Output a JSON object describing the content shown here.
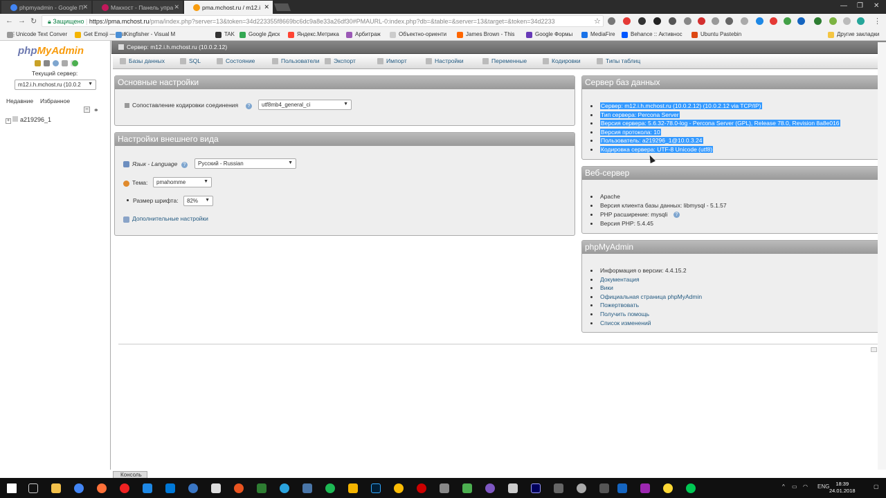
{
  "browser": {
    "tabs": [
      {
        "title": "phpmyadmin - Google П",
        "color": "#4285f4"
      },
      {
        "title": "Макхост - Панель упра",
        "color": "#c2185b"
      },
      {
        "title": "pma.mchost.ru / m12.i",
        "color": "#f89c0e"
      }
    ],
    "url": {
      "secure_label": "Защищено",
      "host": "https://pma.mchost.ru",
      "rest": "/pma/index.php?server=13&token=34d223355f8669bc6dc9a8e33a26df30#PMAURL-0:index.php?db=&table=&server=13&target=&token=34d2233"
    },
    "bookmarks": [
      {
        "label": "Unicode Text Conver",
        "color": "#999999"
      },
      {
        "label": "Get Emoji — List",
        "color": "#f4b400"
      },
      {
        "label": "Kingfisher - Visual M",
        "color": "#4a8fd6"
      },
      {
        "label": "TAK",
        "color": "#333333"
      },
      {
        "label": "Google Диск",
        "color": "#34a853"
      },
      {
        "label": "Яндекс.Метрика",
        "color": "#ff4433"
      },
      {
        "label": "Арбитраж",
        "color": "#9b59b6"
      },
      {
        "label": "Объектно-ориенти",
        "color": "#cccccc"
      },
      {
        "label": "James Brown - This",
        "color": "#ff6600"
      },
      {
        "label": "Google Формы",
        "color": "#673ab7"
      },
      {
        "label": "MediaFire",
        "color": "#1a73e8"
      },
      {
        "label": "Behance :: Активнос",
        "color": "#0057ff"
      },
      {
        "label": "Ubuntu Pastebin",
        "color": "#dd4814"
      }
    ],
    "other_bookmarks": "Другие закладки"
  },
  "sidebar": {
    "logo_php": "php",
    "logo_myadmin": "MyAdmin",
    "current_server_label": "Текущий сервер:",
    "server_value": "m12.i.h.mchost.ru (10.0.2",
    "recent_label": "Недавние",
    "favorites_label": "Избранное",
    "databases": [
      {
        "name": "a219296_1"
      }
    ]
  },
  "breadcrumb": "Сервер: m12.i.h.mchost.ru (10.0.2.12)",
  "menu": [
    "Базы данных",
    "SQL",
    "Состояние",
    "Пользователи",
    "Экспорт",
    "Импорт",
    "Настройки",
    "Переменные",
    "Кодировки",
    "Типы таблиц"
  ],
  "general_settings": {
    "title": "Основные настройки",
    "collation_label": "Сопоставление кодировки соединения",
    "collation_value": "utf8mb4_general_ci"
  },
  "appearance": {
    "title": "Настройки внешнего вида",
    "language_label": "Язык - Language",
    "language_value": "Русский - Russian",
    "theme_label": "Тема:",
    "theme_value": "pmahomme",
    "font_label": "Размер шрифта:",
    "font_value": "82%",
    "more_settings": "Дополнительные настройки"
  },
  "db_server": {
    "title": "Сервер баз данных",
    "items": [
      "Сервер: m12.i.h.mchost.ru (10.0.2.12) (10.0.2.12 via TCP/IP)",
      "Тип сервера: Percona Server",
      "Версия сервера: 5.6.32-78.0-log - Percona Server (GPL), Release 78.0, Revision 8a8e016",
      "Версия протокола: 10",
      "Пользователь: a219296_1@10.0.3.24",
      "Кодировка сервера: UTF-8 Unicode (utf8)"
    ]
  },
  "web_server": {
    "title": "Веб-сервер",
    "items": [
      "Apache",
      "Версия клиента базы данных: libmysql - 5.1.57",
      "PHP расширение: mysqli",
      "Версия PHP: 5.4.45"
    ]
  },
  "pma": {
    "title": "phpMyAdmin",
    "items": [
      "Информация о версии: 4.4.15.2",
      "Документация",
      "Вики",
      "Официальная страница phpMyAdmin",
      "Пожертвовать",
      "Получить помощь",
      "Список изменений"
    ]
  },
  "console_label": "Консоль",
  "taskbar": {
    "lang": "ENG",
    "time": "18:39",
    "date": "24.01.2018"
  }
}
